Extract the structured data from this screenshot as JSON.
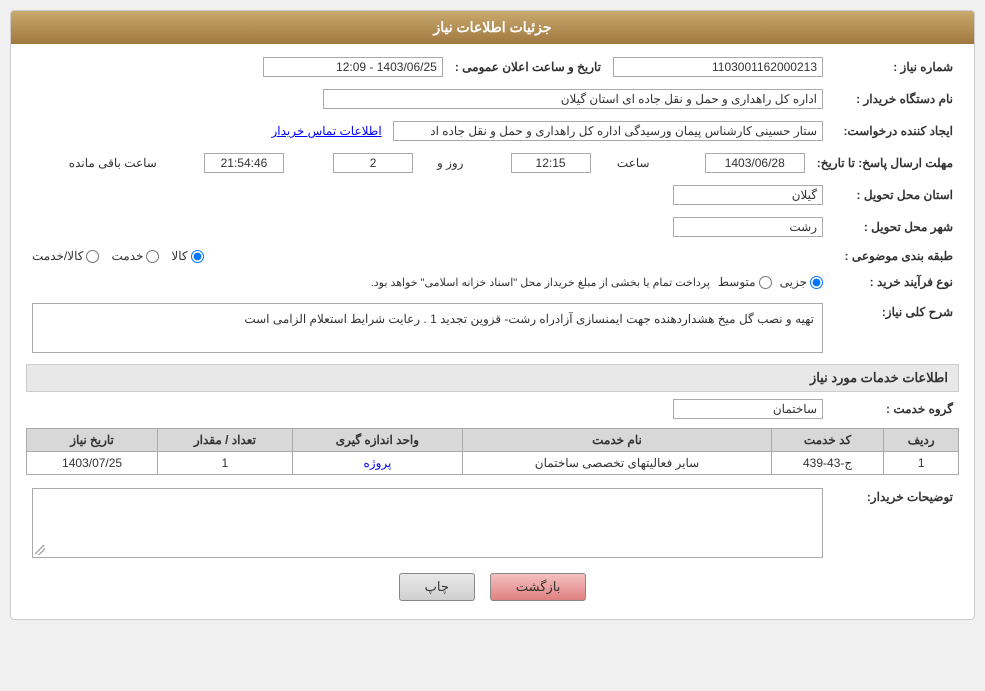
{
  "header": {
    "title": "جزئیات اطلاعات نیاز"
  },
  "fields": {
    "shomare_niaz_label": "شماره نیاز :",
    "shomare_niaz_value": "1103001162000213",
    "nam_dastgah_label": "نام دستگاه خریدار :",
    "nam_dastgah_value": "اداره کل راهداری و حمل و نقل جاده ای استان گیلان",
    "ijad_konande_label": "ایجاد کننده درخواست:",
    "ijad_konande_value": "ستار حسینی کارشناس پیمان ورسیدگی اداره کل راهداری و حمل و نقل جاده اد",
    "ijad_konande_link": "اطلاعات تماس خریدار",
    "mohlat_label": "مهلت ارسال پاسخ: تا تاریخ:",
    "date_value": "1403/06/28",
    "saat_label": "ساعت",
    "saat_value": "12:15",
    "rooz_label": "روز و",
    "rooz_value": "2",
    "baqi_label": "ساعت باقی مانده",
    "baqi_value": "21:54:46",
    "tarikh_label": "تاریخ و ساعت اعلان عمومی :",
    "tarikh_value": "1403/06/25 - 12:09",
    "ostan_label": "استان محل تحویل :",
    "ostan_value": "گیلان",
    "shahr_label": "شهر محل تحویل :",
    "shahr_value": "رشت",
    "tabaqe_label": "طبقه بندی موضوعی :",
    "tabaqe_options": [
      "کالا",
      "خدمت",
      "کالا/خدمت"
    ],
    "tabaqe_selected": "کالا",
    "nouz_label": "نوع فرآیند خرید :",
    "nouz_options": [
      "جزیی",
      "متوسط"
    ],
    "nouz_note": "پرداخت تمام یا بخشی از مبلغ خریداز محل \"اسناد خزانه اسلامی\" خواهد بود."
  },
  "sharh": {
    "section_title": "شرح کلی نیاز:",
    "text": "تهیه و نصب گل میخ هشداردهنده جهت ایمنسازی آزادراه رشت- قزوین تجدید 1 . رعایت شرایط استعلام الزامی است"
  },
  "khadamat": {
    "section_title": "اطلاعات خدمات مورد نیاز",
    "group_label": "گروه خدمت :",
    "group_value": "ساختمان",
    "table": {
      "headers": [
        "ردیف",
        "کد خدمت",
        "نام خدمت",
        "واحد اندازه گیری",
        "تعداد / مقدار",
        "تاریخ نیاز"
      ],
      "rows": [
        {
          "radif": "1",
          "kod": "ج-43-439",
          "nam": "سایر فعالیتهای تخصصی ساختمان",
          "vahed": "پروژه",
          "tedad": "1",
          "tarikh": "1403/07/25"
        }
      ]
    }
  },
  "tawzihat": {
    "label": "توضیحات خریدار:",
    "value": ""
  },
  "buttons": {
    "print": "چاپ",
    "back": "بازگشت"
  }
}
